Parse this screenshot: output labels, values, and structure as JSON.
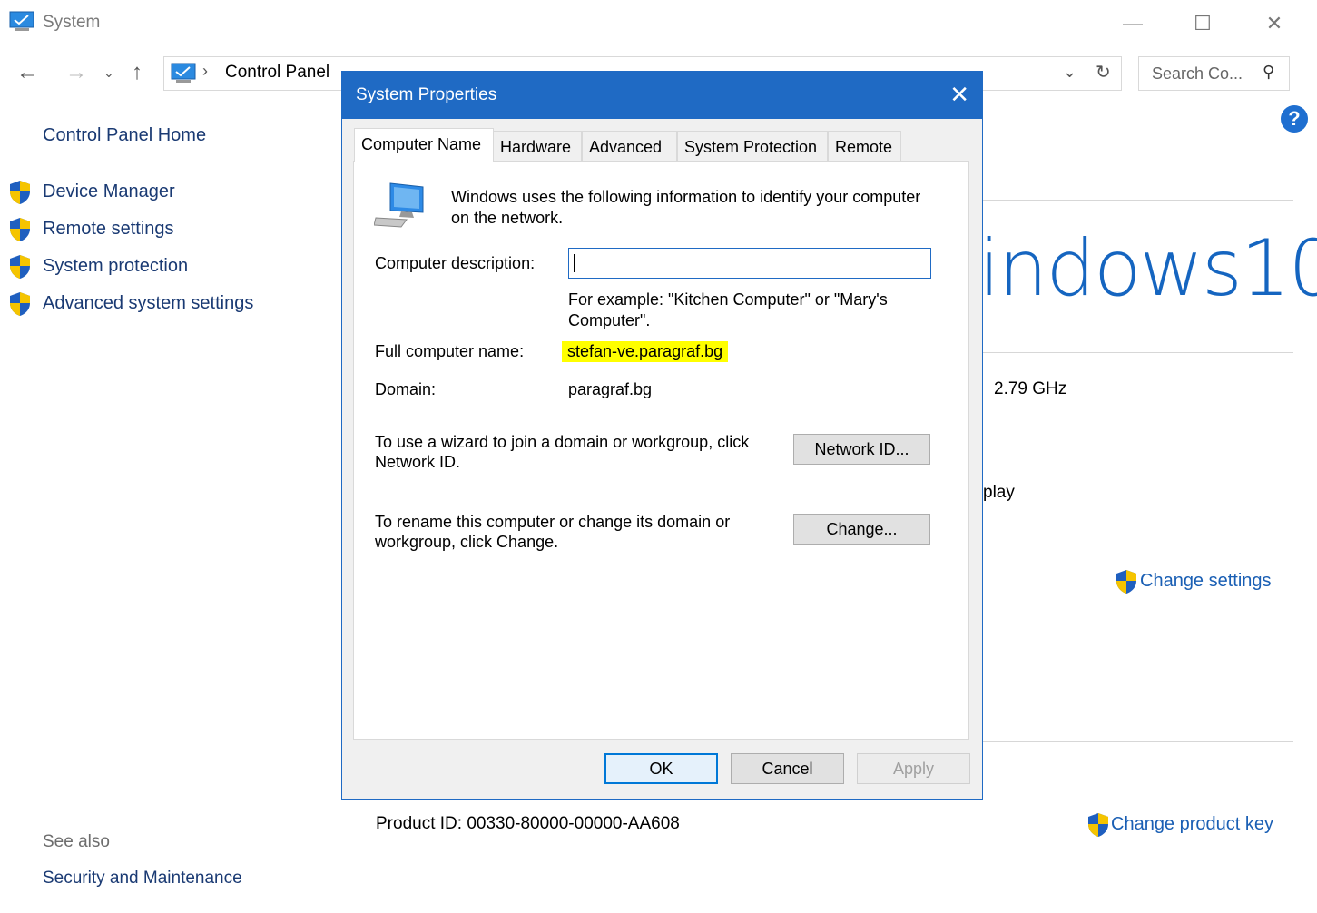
{
  "window": {
    "title": "System",
    "minimize_icon": "minimize-icon",
    "maximize_icon": "maximize-icon",
    "close_icon": "close-icon"
  },
  "nav": {
    "address_visible": "Control Panel",
    "search_placeholder": "Search Co..."
  },
  "left_pane": {
    "home": "Control Panel Home",
    "links": [
      "Device Manager",
      "Remote settings",
      "System protection",
      "Advanced system settings"
    ],
    "see_also": "See also",
    "see_also_links": [
      "Security and Maintenance"
    ]
  },
  "main": {
    "logo_text": "indows10",
    "processor_speed": "2.79 GHz",
    "partial_display": "play",
    "change_settings": "Change settings",
    "product_id": "Product ID:  00330-80000-00000-AA608",
    "change_product_key": "Change product key"
  },
  "dialog": {
    "title": "System Properties",
    "tabs": [
      "Computer Name",
      "Hardware",
      "Advanced",
      "System Protection",
      "Remote"
    ],
    "intro_line1": "Windows uses the following information to identify your computer",
    "intro_line2": "on the network.",
    "description_label": "Computer description:",
    "description_value": "",
    "example_line1": "For example: \"Kitchen Computer\" or \"Mary's",
    "example_line2": "Computer\".",
    "full_name_label": "Full computer name:",
    "full_name_value": "stefan-ve.paragraf.bg",
    "domain_label": "Domain:",
    "domain_value": "paragraf.bg",
    "network_text_line1": "To use a wizard to join a domain or workgroup, click",
    "network_text_line2": "Network ID.",
    "network_button": "Network ID...",
    "rename_text_line1": "To rename this computer or change its domain or",
    "rename_text_line2": "workgroup, click Change.",
    "change_button": "Change...",
    "ok": "OK",
    "cancel": "Cancel",
    "apply": "Apply",
    "highlight_color": "#ffff00",
    "accent_color": "#1f6ac4"
  }
}
